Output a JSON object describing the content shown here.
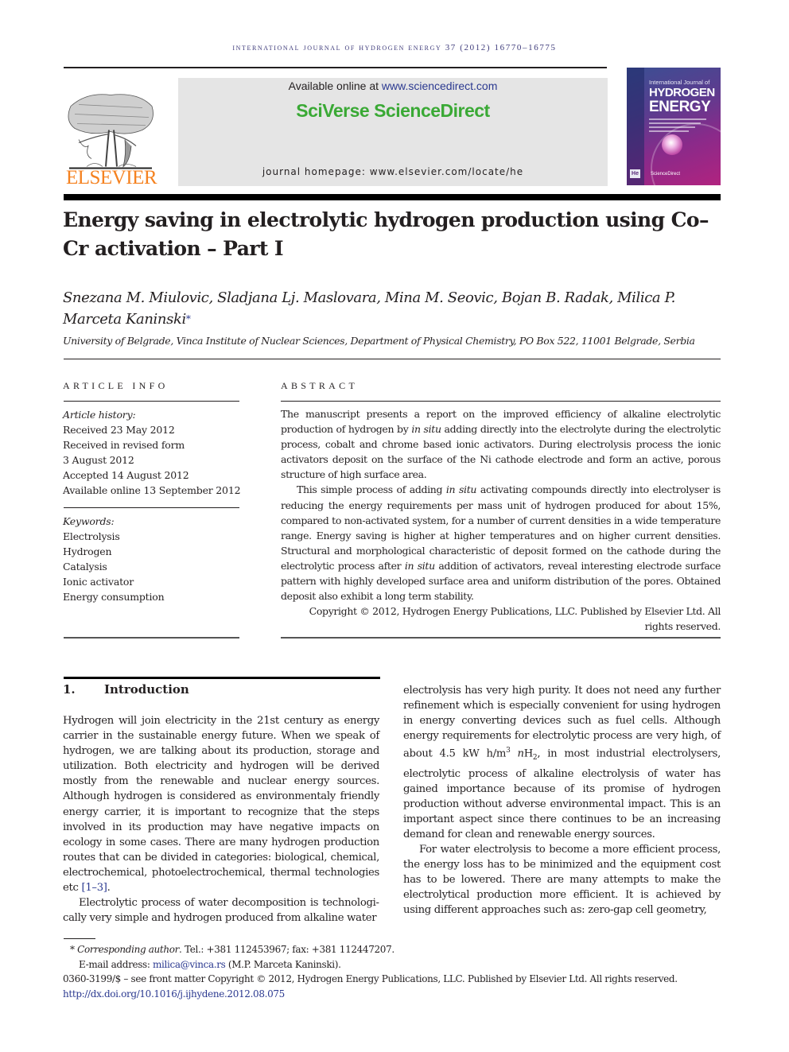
{
  "running_header": "INTERNATIONAL JOURNAL OF HYDROGEN ENERGY 37 (2012) 16770–16775",
  "publisher": {
    "logo_icon": "elsevier-tree-icon",
    "name": "ELSEVIER",
    "brand_color": "#f58220"
  },
  "banner": {
    "available_prefix": "Available online at ",
    "available_link": "www.sciencedirect.com",
    "platform_name": "SciVerse ScienceDirect",
    "platform_color": "#3aa935",
    "homepage_line": "journal homepage: www.elsevier.com/locate/he"
  },
  "cover": {
    "line1": "International Journal of",
    "line2": "HYDROGEN",
    "line3": "ENERGY",
    "badge": "He",
    "footer": "ScienceDirect"
  },
  "article": {
    "title": "Energy saving in electrolytic hydrogen production using Co–Cr activation – Part I",
    "authors": "Snezana M. Miulovic, Sladjana Lj. Maslovara, Mina M. Seovic, Bojan B. Radak, Milica P. Marceta Kaninski",
    "corresponding_mark": "*",
    "affiliation": "University of Belgrade, Vinca Institute of Nuclear Sciences, Department of Physical Chemistry, PO Box 522, 11001 Belgrade, Serbia"
  },
  "article_info": {
    "label": "ARTICLE INFO",
    "history_heading": "Article history:",
    "history": [
      "Received 23 May 2012",
      "Received in revised form",
      "3 August 2012",
      "Accepted 14 August 2012",
      "Available online 13 September 2012"
    ],
    "keywords_heading": "Keywords:",
    "keywords": [
      "Electrolysis",
      "Hydrogen",
      "Catalysis",
      "Ionic activator",
      "Energy consumption"
    ]
  },
  "abstract": {
    "label": "ABSTRACT",
    "p1_a": "The manuscript presents a report on the improved efficiency of alkaline electrolytic production of hydrogen by ",
    "p1_italic": "in situ",
    "p1_b": " adding directly into the electrolyte during the electrolytic process, cobalt and chrome based ionic activators. During electrolysis process the ionic activators deposit on the surface of the Ni cathode electrode and form an active, porous structure of high surface area.",
    "p2_a": "This simple process of adding ",
    "p2_italic": "in situ",
    "p2_b": " activating compounds directly into electrolyser is reducing the energy requirements per mass unit of hydrogen produced for about 15%, compared to non-activated system, for a number of current densities in a wide tempera­ture range. Energy saving is higher at higher temperatures and on higher current densities. Structural and morphological characteristic of deposit formed on the cathode during the electrolytic process after ",
    "p2_italic2": "in situ",
    "p2_c": " addition of activators, reveal interesting electrode surface pattern with highly developed surface area and uniform distribution of the pores. Obtained deposit also exhibit a long term stability.",
    "copyright": "Copyright © 2012, Hydrogen Energy Publications, LLC. Published by Elsevier Ltd. All rights reserved."
  },
  "introduction": {
    "number": "1.",
    "heading": "Introduction",
    "left_p1_a": "Hydrogen will join electricity in the 21st century as energy carrier in the sustainable energy future. When we speak of hydrogen, we are talking about its production, storage and utilization. Both electricity and hydrogen will be derived mostly from the renewable and nuclear energy sources. Although hydrogen is considered as environmentaly friendly energy carrier, it is important to recognize that the steps involved in its production may have negative impacts on ecology in some cases. There are many hydrogen production routes that can be divided in categories: biological, chemical, electrochemical, photoelectrochemical, thermal technologies etc ",
    "left_p1_ref": "[1–3]",
    "left_p1_end": ".",
    "left_p2": "Electrolytic process of water decomposition is technologi­cally very simple and hydrogen produced from alkaline water",
    "right_p1_a": "electrolysis has very high purity. It does not need any further refinement which is especially convenient for using hydrogen in energy converting devices such as fuel cells. Although energy requirements for electrolytic process are very high, of about 4.5 kW h/m",
    "right_p1_sup": "3",
    "right_p1_n": " n",
    "right_p1_h": "H",
    "right_p1_sub": "2",
    "right_p1_b": ", in most industrial electrolysers, electrolytic process of alkaline electrolysis of water has gained importance because of its promise of hydrogen production without adverse environmental impact. This is an important aspect since there continues to be an increasing demand for clean and renewable energy sources.",
    "right_p2": "For water electrolysis to become a more efficient process, the energy loss has to be minimized and the equipment cost has to be lowered. There are many attempts to make the electrolytical production more efficient. It is achieved by using different approaches such as: zero-gap cell geometry,"
  },
  "footnotes": {
    "star": "*",
    "corresponding_label": "Corresponding author",
    "contact": ". Tel.: +381 112453967; fax: +381 112447207.",
    "email_label": "E-mail address: ",
    "email": "milica@vinca.rs",
    "email_name": " (M.P. Marceta Kaninski).",
    "front_matter": "0360-3199/$ – see front matter Copyright © 2012, Hydrogen Energy Publications, LLC. Published by Elsevier Ltd. All rights reserved.",
    "doi": "http://dx.doi.org/10.1016/j.ijhydene.2012.08.075"
  },
  "colors": {
    "link": "#2b3990",
    "header_text": "#3d3a7a",
    "banner_bg": "#e5e5e5"
  }
}
